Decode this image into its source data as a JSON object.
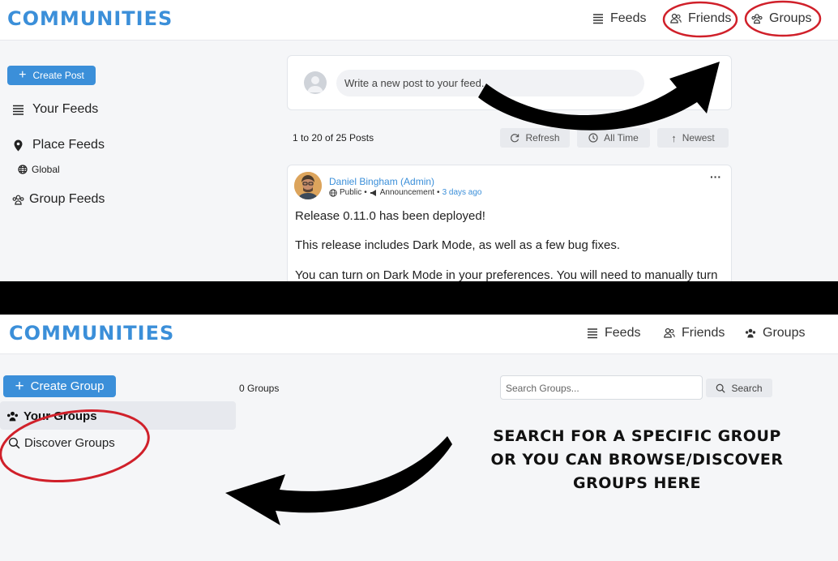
{
  "top_screen": {
    "brand": "COMMUNITIES",
    "nav": {
      "feeds": "Feeds",
      "friends": "Friends",
      "groups": "Groups"
    },
    "sidebar": {
      "create_post": "Create Post",
      "your_feeds": "Your Feeds",
      "place_feeds": "Place Feeds",
      "global": "Global",
      "group_feeds": "Group Feeds"
    },
    "composer": {
      "placeholder": "Write a new post to your feed..."
    },
    "toolbar": {
      "count": "1 to 20 of 25 Posts",
      "refresh": "Refresh",
      "all_time": "All Time",
      "newest": "Newest"
    },
    "post": {
      "author": "Daniel Bingham (Admin)",
      "visibility": "Public",
      "type": "Announcement",
      "time": "3 days ago",
      "menu": "···",
      "lines": [
        "Release 0.11.0 has been deployed!",
        "This release includes Dark Mode, as well as a few bug fixes.",
        "You can turn on Dark Mode in your preferences. You will need to manually turn"
      ]
    }
  },
  "bottom_screen": {
    "brand": "COMMUNITIES",
    "nav": {
      "feeds": "Feeds",
      "friends": "Friends",
      "groups": "Groups"
    },
    "sidebar": {
      "create_group": "Create Group",
      "your_groups": "Your Groups",
      "discover_groups": "Discover Groups"
    },
    "groups_count": "0 Groups",
    "search": {
      "placeholder": "Search Groups...",
      "button": "Search"
    }
  },
  "annotation": {
    "caption": "SEARCH FOR A SPECIFIC GROUP OR YOU CAN BROWSE/DISCOVER GROUPS HERE"
  },
  "colors": {
    "brand_blue": "#3b8fd9",
    "annotation_red": "#d0202a",
    "arrow_black": "#000000"
  }
}
